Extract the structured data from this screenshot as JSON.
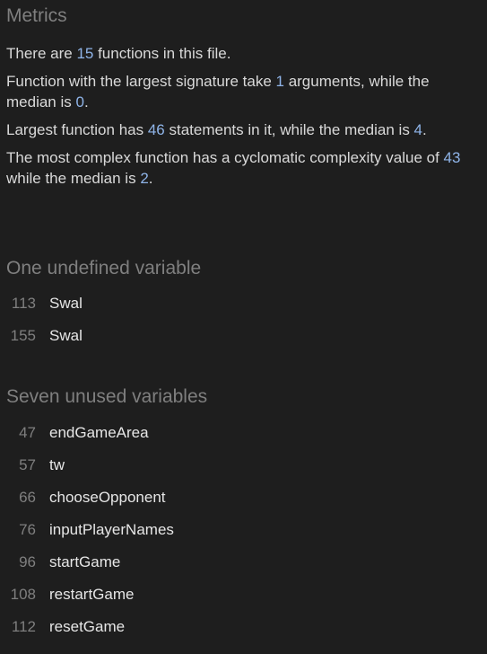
{
  "metrics": {
    "title": "Metrics",
    "functions_count": {
      "prefix": "There are ",
      "value": "15",
      "suffix": " functions in this file."
    },
    "signature": {
      "prefix": "Function with the largest signature take ",
      "value": "1",
      "middle": " arguments, while the median is ",
      "median": "0",
      "suffix": "."
    },
    "statements": {
      "prefix": "Largest function has ",
      "value": "46",
      "middle": " statements in it, while the median is ",
      "median": "4",
      "suffix": "."
    },
    "complexity": {
      "prefix": "The most complex function has a cyclomatic complexity value of ",
      "value": "43",
      "middle": " while the median is ",
      "median": "2",
      "suffix": "."
    }
  },
  "undefined_variables": {
    "title": "One undefined variable",
    "items": [
      {
        "line": "113",
        "name": "Swal"
      },
      {
        "line": "155",
        "name": "Swal"
      }
    ]
  },
  "unused_variables": {
    "title": "Seven unused variables",
    "items": [
      {
        "line": "47",
        "name": "endGameArea"
      },
      {
        "line": "57",
        "name": "tw"
      },
      {
        "line": "66",
        "name": "chooseOpponent"
      },
      {
        "line": "76",
        "name": "inputPlayerNames"
      },
      {
        "line": "96",
        "name": "startGame"
      },
      {
        "line": "108",
        "name": "restartGame"
      },
      {
        "line": "112",
        "name": "resetGame"
      }
    ]
  }
}
